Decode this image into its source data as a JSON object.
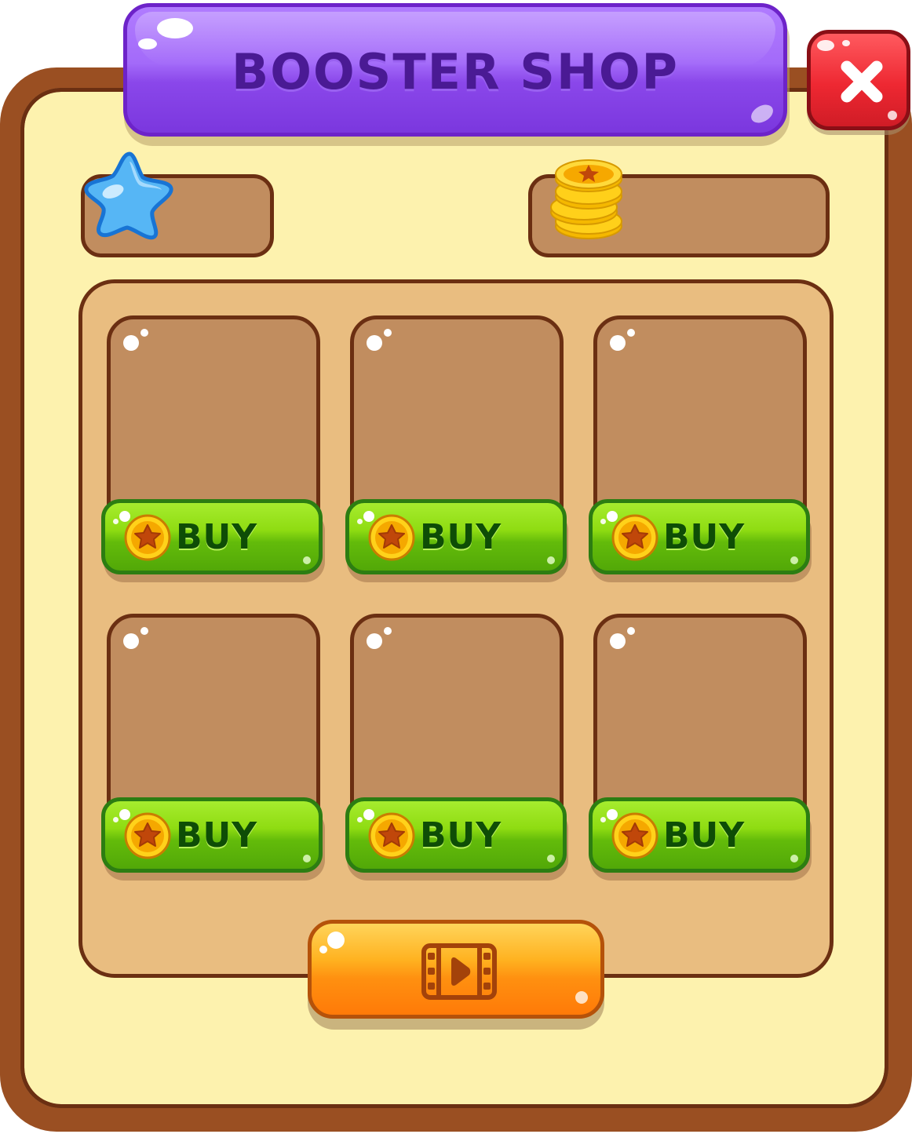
{
  "header": {
    "title": "BOOSTER SHOP"
  },
  "currencies": [
    {
      "name": "star-currency",
      "icon": "blue-star-icon",
      "value": ""
    },
    {
      "name": "coin-currency",
      "icon": "gold-coin-stack-icon",
      "value": ""
    }
  ],
  "boosters": [
    {
      "buy_label": "BUY",
      "price_icon": "coin-icon"
    },
    {
      "buy_label": "BUY",
      "price_icon": "coin-icon"
    },
    {
      "buy_label": "BUY",
      "price_icon": "coin-icon"
    },
    {
      "buy_label": "BUY",
      "price_icon": "coin-icon"
    },
    {
      "buy_label": "BUY",
      "price_icon": "coin-icon"
    },
    {
      "buy_label": "BUY",
      "price_icon": "coin-icon"
    }
  ],
  "actions": {
    "close_icon": "close-icon",
    "watch_video_icon": "film-play-icon"
  },
  "colors": {
    "frame": "#9a4f22",
    "panel": "#fdf2ae",
    "title": "#a36af9",
    "close": "#ee2832",
    "buy": "#8fdc12",
    "video": "#ffa318"
  }
}
